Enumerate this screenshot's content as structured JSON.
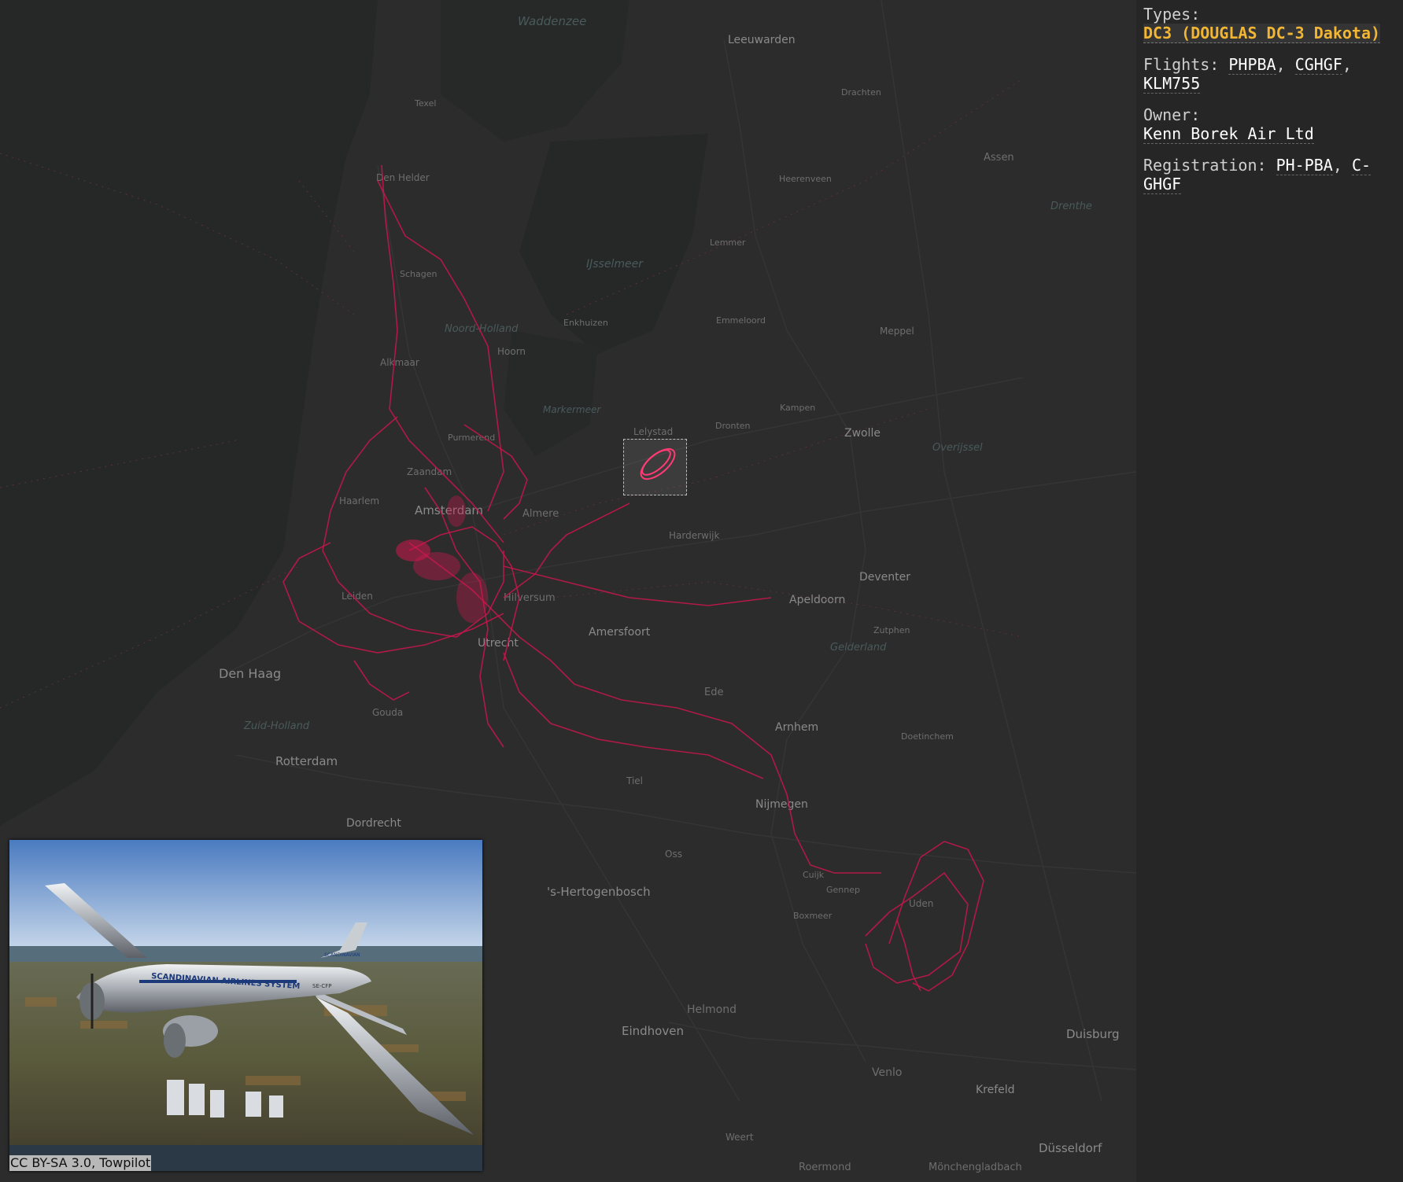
{
  "panel": {
    "types_label": "Types:",
    "types_value": "DC3 (DOUGLAS DC-3 Dakota)",
    "flights_label": "Flights:",
    "flights": [
      "PHPBA",
      "CGHGF",
      "KLM755"
    ],
    "owner_label": "Owner:",
    "owner_value": "Kenn Borek Air Ltd",
    "registration_label": "Registration:",
    "registrations": [
      "PH-PBA",
      "C-GHGF"
    ]
  },
  "photo": {
    "credit": "CC BY-SA 3.0, Towpilot",
    "fuselage_text": "SCANDINAVIAN AIRLINES SYSTEM",
    "tail_text": "SCANDINAVIAN",
    "registration_text": "SE-CFP"
  },
  "map": {
    "places": {
      "leeuwarden": "Leeuwarden",
      "den_helder": "Den Helder",
      "amsterdam": "Amsterdam",
      "den_haag": "Den Haag",
      "rotterdam": "Rotterdam",
      "utrecht": "Utrecht",
      "zwolle": "Zwolle",
      "lelystad": "Lelystad",
      "almere": "Almere",
      "amersfoort": "Amersfoort",
      "apeldoorn": "Apeldoorn",
      "deventer": "Deventer",
      "arnhem": "Arnhem",
      "nijmegen": "Nijmegen",
      "s_hertogenbosch": "'s-Hertogenbosch",
      "eindhoven": "Eindhoven",
      "venlo": "Venlo",
      "dusseldorf": "Düsseldorf",
      "duisburg": "Duisburg",
      "assen": "Assen",
      "emmeloord": "Emmeloord",
      "hilversum": "Hilversum",
      "haarlem": "Haarlem",
      "leiden": "Leiden",
      "dordrecht": "Dordrecht",
      "helmond": "Helmond",
      "zaandam": "Zaandam",
      "alkmaar": "Alkmaar",
      "hoorn": "Hoorn",
      "enkhuizen": "Enkhuizen",
      "meppel": "Meppel",
      "lemmer": "Lemmer",
      "heerenveen": "Heerenveen",
      "drachten": "Drachten",
      "ede": "Ede",
      "tiel": "Tiel",
      "gouda": "Gouda",
      "krefeld": "Krefeld",
      "texel": "Texel",
      "schagen": "Schagen",
      "purmerend": "Purmerend",
      "harderwijk": "Harderwijk",
      "kampen": "Kampen",
      "dronten": "Dronten",
      "doetinchem": "Doetinchem",
      "zutphen": "Zutphen",
      "oss": "Oss",
      "uden": "Uden",
      "boxmeer": "Boxmeer",
      "gennep": "Gennep",
      "cuijk": "Cuijk",
      "weert": "Weert",
      "roermond": "Roermond",
      "mönchengladbach": "Mönchengladbach",
      "waddenzee": "Waddenzee",
      "ijsselmeer": "IJsselmeer",
      "markermeer": "Markermeer",
      "noord_holland": "Noord-Holland",
      "gelderland": "Gelderland",
      "zuid_holland": "Zuid-Holland",
      "overijssel": "Overijssel",
      "drenthe": "Drenthe"
    }
  }
}
